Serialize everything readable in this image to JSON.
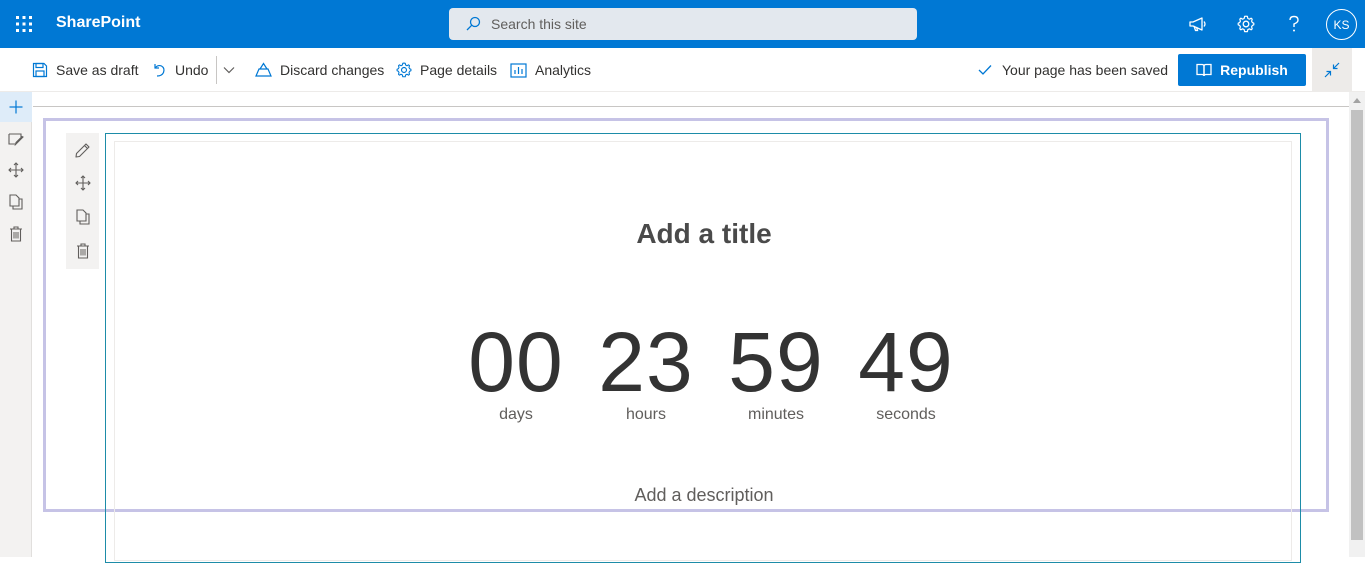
{
  "suite_bar": {
    "app_name": "SharePoint",
    "search_placeholder": "Search this site",
    "user_initials": "KS",
    "icons": [
      "app-launcher-icon",
      "search-icon",
      "megaphone-icon",
      "settings-gear-icon",
      "help-icon"
    ],
    "accent_color": "#0078d4"
  },
  "command_bar": {
    "save_as_draft": "Save as draft",
    "undo": "Undo",
    "discard_changes": "Discard changes",
    "page_details": "Page details",
    "analytics": "Analytics",
    "status": "Your page has been saved",
    "republish": "Republish"
  },
  "countdown": {
    "title": "Add a title",
    "days_value": "00",
    "days_label": "days",
    "hours_value": "23",
    "hours_label": "hours",
    "minutes_value": "59",
    "minutes_label": "minutes",
    "seconds_value": "49",
    "seconds_label": "seconds",
    "description": "Add a description"
  },
  "colors": {
    "section_border": "#c6c3e6",
    "webpart_border": "#1d8ca8",
    "primary_button": "#0078d4"
  }
}
